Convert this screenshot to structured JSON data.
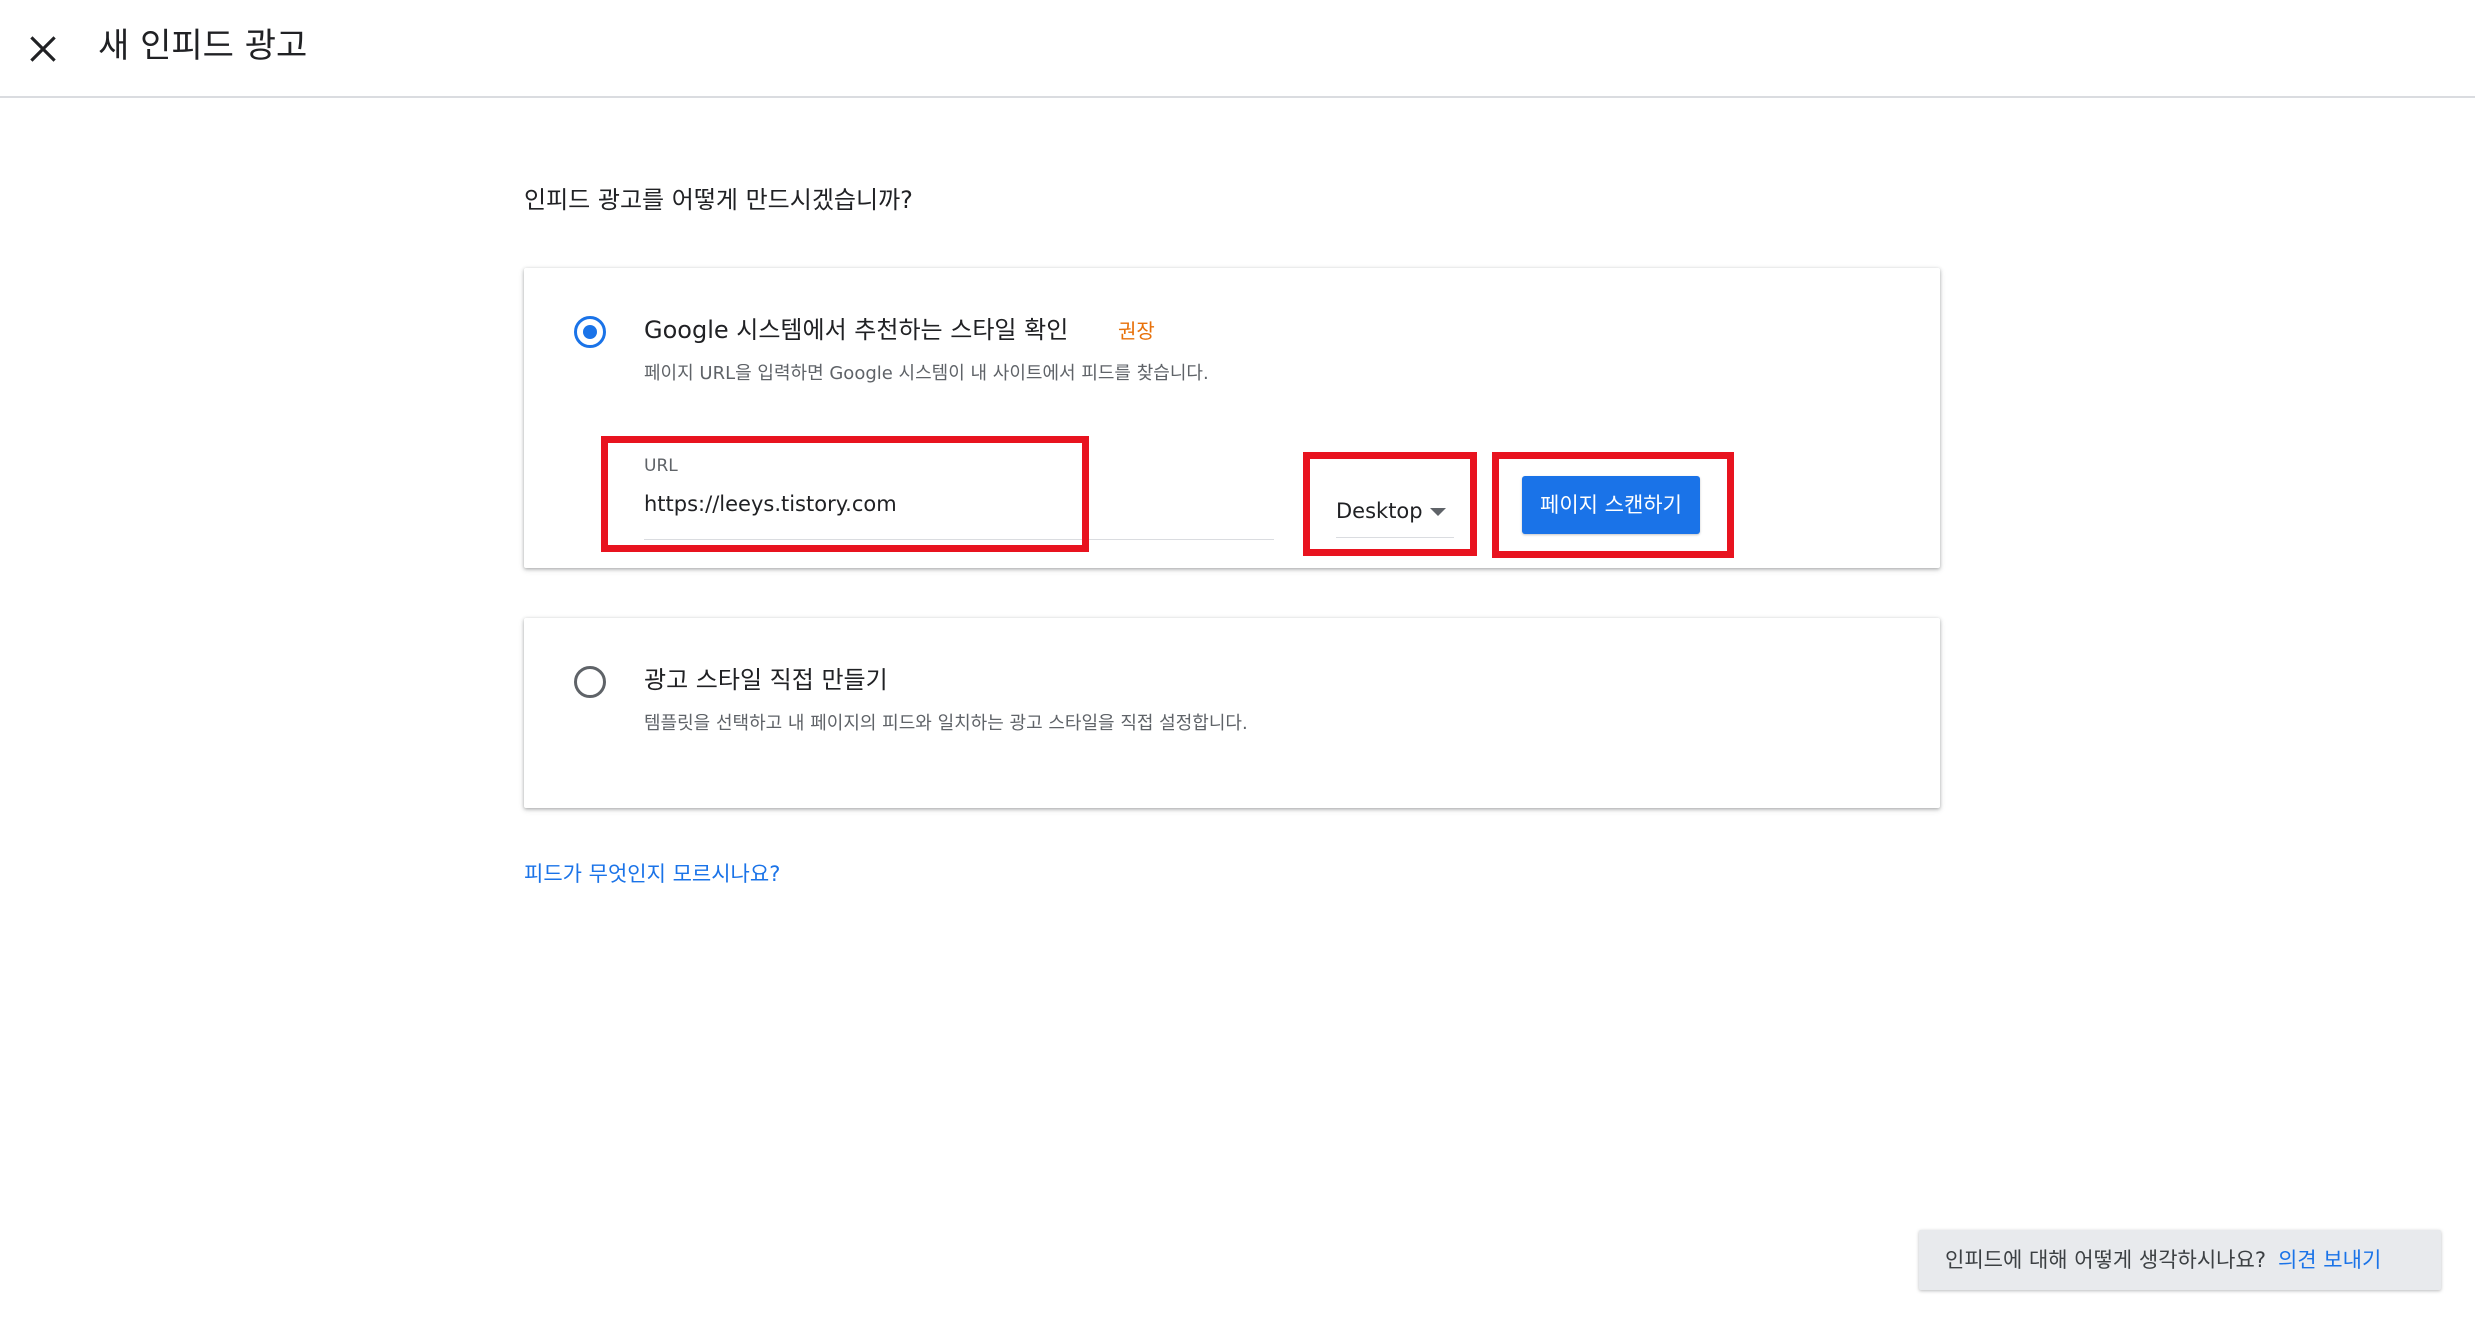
{
  "header": {
    "title": "새 인피드 광고",
    "close_icon": "close-icon"
  },
  "main": {
    "question": "인피드 광고를 어떻게 만드시겠습니까?",
    "help_link": "피드가 무엇인지 모르시나요?"
  },
  "option_google": {
    "selected": true,
    "title": "Google 시스템에서 추천하는 스타일 확인",
    "badge": "권장",
    "description": "페이지 URL을 입력하면 Google 시스템이 내 사이트에서 피드를 찾습니다.",
    "url_label": "URL",
    "url_value": "https://leeys.tistory.com",
    "device_value": "Desktop",
    "scan_button": "페이지 스캔하기"
  },
  "option_manual": {
    "selected": false,
    "title": "광고 스타일 직접 만들기",
    "description": "템플릿을 선택하고 내 페이지의 피드와 일치하는 광고 스타일을 직접 설정합니다."
  },
  "feedback": {
    "question": "인피드에 대해 어떻게 생각하시나요?",
    "link": "의견 보내기"
  },
  "colors": {
    "accent": "#1a73e8",
    "badge": "#e8710a",
    "highlight": "#e8131f"
  }
}
